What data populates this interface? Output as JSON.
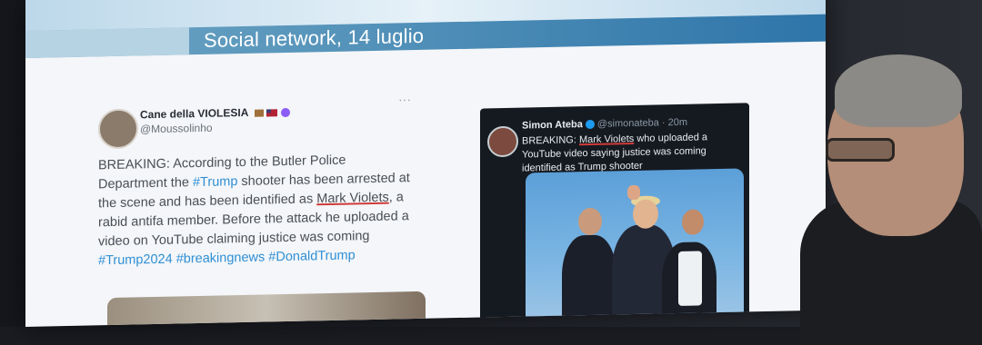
{
  "slide": {
    "title": "Social network, 14 luglio"
  },
  "tweet_left": {
    "display_name": "Cane della VIOLESIA",
    "handle": "@Moussolinho",
    "more_menu": "···",
    "text_parts": [
      "BREAKING: According to the Butler Police Department the ",
      "#Trump",
      " shooter has been arrested at the scene and has been identified as ",
      "Mark Violets",
      ", a rabid antifa member. Before the attack he uploaded a video on YouTube claiming justice was coming ",
      "#Trump2024",
      " ",
      "#breakingnews",
      " ",
      "#DonaldTrump"
    ]
  },
  "tweet_right": {
    "display_name": "Simon Ateba",
    "meta": "@simonateba · 20m",
    "more_menu": "⋮",
    "text_prefix": "BREAKING: ",
    "text_highlight": "Mark Violets",
    "text_rest": " who uploaded a YouTube video saying justice was coming identified as Trump shooter"
  },
  "colors": {
    "header_band": "#2e75a9",
    "hashtag": "#2f8fd4",
    "underline": "#d03a3a",
    "tweet_dark_bg": "#151a21"
  }
}
